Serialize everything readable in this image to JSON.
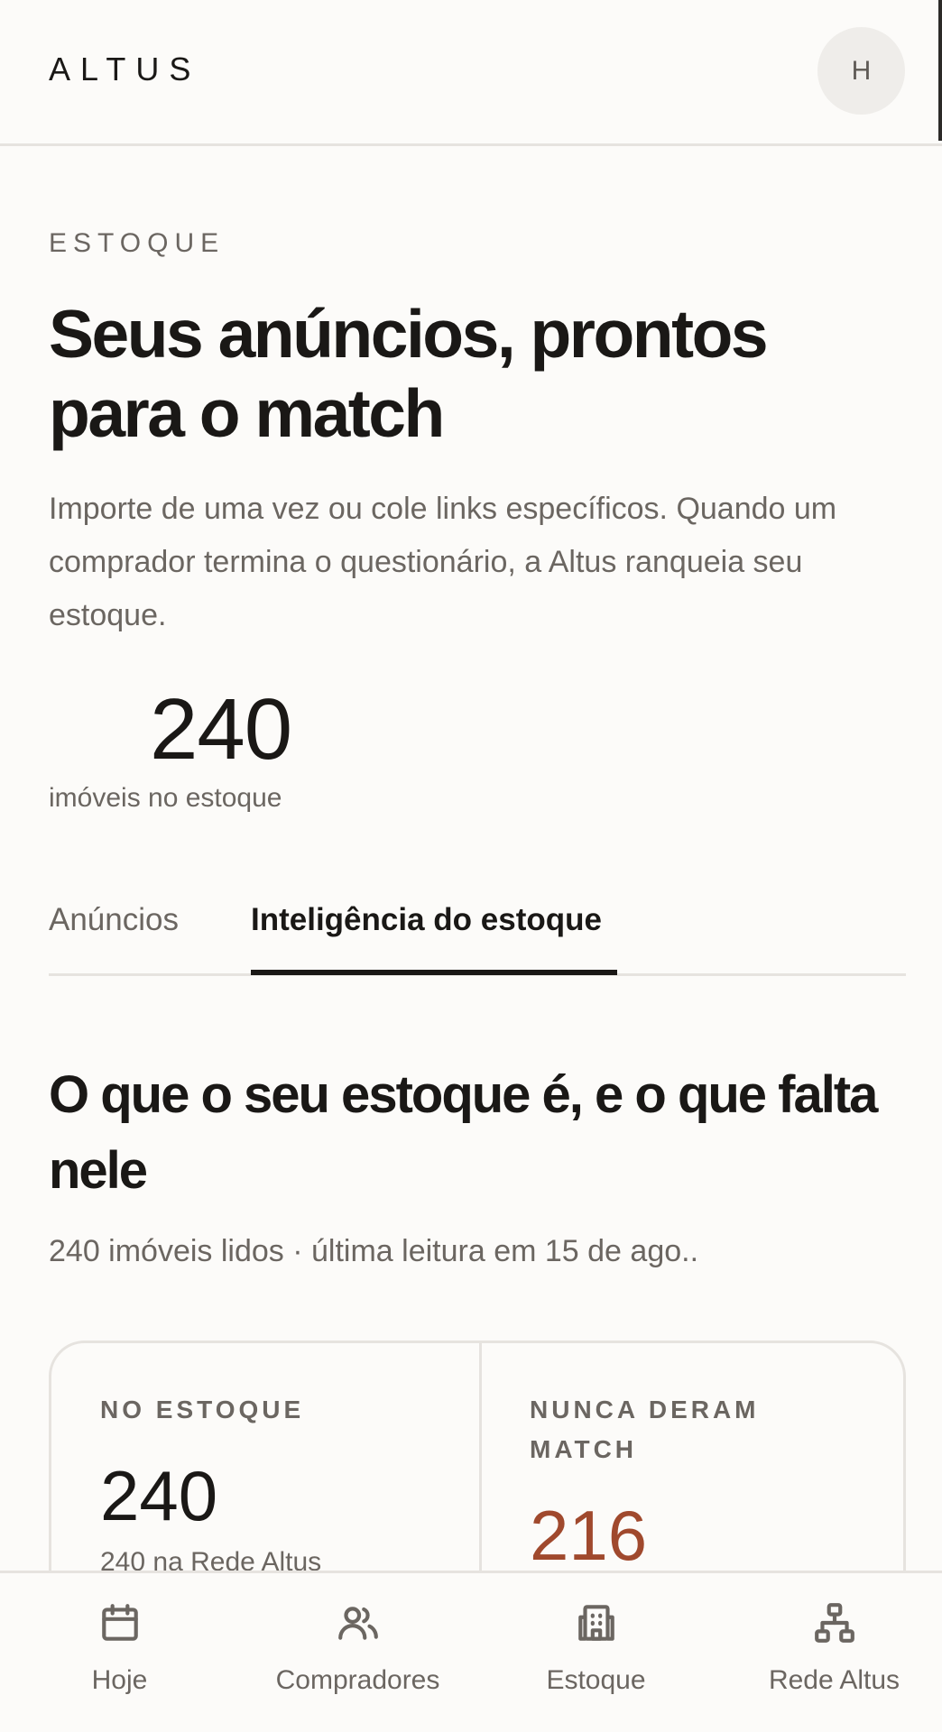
{
  "header": {
    "logo": "ALTUS",
    "avatar_initial": "H"
  },
  "main": {
    "eyebrow": "ESTOQUE",
    "title": "Seus anúncios, prontos para o match",
    "description": "Importe de uma vez ou cole links específicos. Quando um comprador termina o questionário, a Altus ranqueia seu estoque.",
    "stat_value": "240",
    "stat_caption": "imóveis no estoque"
  },
  "tabs": [
    {
      "label": "Anúncios",
      "active": false
    },
    {
      "label": "Inteligência do estoque",
      "active": true
    }
  ],
  "section": {
    "title": "O que o seu estoque é, e o que falta nele",
    "meta": "240 imóveis lidos · última leitura em 15 de ago.."
  },
  "cards": [
    {
      "label": "NO ESTOQUE",
      "value": "240",
      "sub": "240 na Rede Altus"
    },
    {
      "label": "NUNCA DERAM MATCH",
      "value": "216"
    }
  ],
  "bottom_nav": [
    {
      "label": "Hoje",
      "icon": "calendar-icon"
    },
    {
      "label": "Compradores",
      "icon": "users-icon"
    },
    {
      "label": "Estoque",
      "icon": "building-icon"
    },
    {
      "label": "Rede Altus",
      "icon": "network-icon"
    }
  ],
  "colors": {
    "background": "#fcfbf9",
    "text": "#1a1816",
    "muted": "#6b6661",
    "accent": "#a0492d",
    "border": "#e6e3df"
  }
}
